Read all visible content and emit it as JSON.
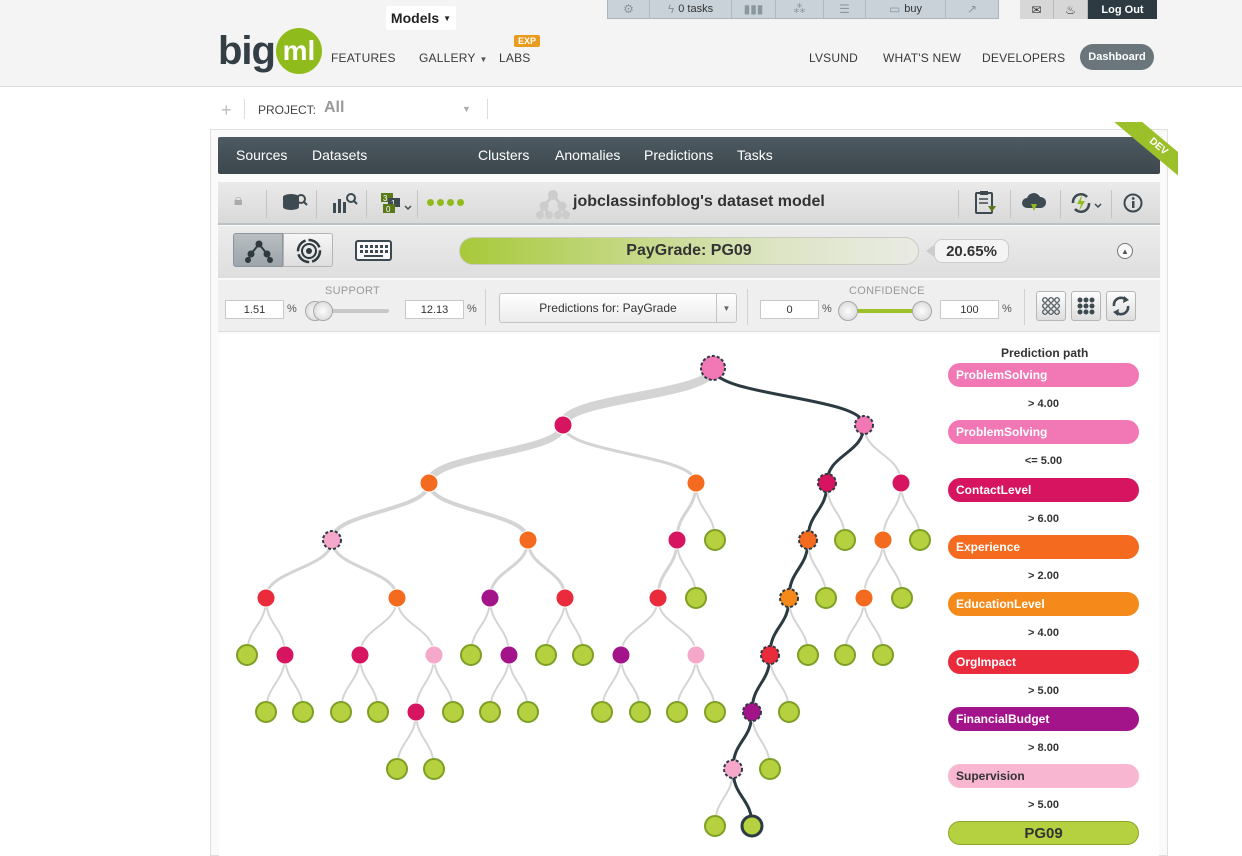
{
  "topbar": {
    "tasks_label": "0 tasks",
    "buy_label": "buy",
    "logout_label": "Log Out",
    "nav": {
      "features": "FEATURES",
      "gallery": "GALLERY",
      "labs": "LABS",
      "labs_badge": "EXP",
      "user": "LVSUND",
      "whats_new": "WHAT'S NEW",
      "developers": "DEVELOPERS",
      "dashboard": "Dashboard"
    },
    "logo": {
      "text": "big",
      "badge": "ml"
    }
  },
  "project": {
    "label": "PROJECT:",
    "value": "All"
  },
  "main_nav": {
    "tabs": [
      "Sources",
      "Datasets",
      "Models",
      "Clusters",
      "Anomalies",
      "Predictions",
      "Tasks"
    ],
    "ribbon": "DEV"
  },
  "model": {
    "title": "jobclassinfoblog's dataset model"
  },
  "prediction": {
    "label": "PayGrade: PG09",
    "percent": "20.65%"
  },
  "filters": {
    "support_label": "SUPPORT",
    "support_min": "1.51",
    "support_max": "12.13",
    "percent_sign": "%",
    "select_value": "Predictions for: PayGrade",
    "confidence_label": "CONFIDENCE",
    "confidence_min": "0",
    "confidence_max": "100"
  },
  "prediction_path": {
    "title": "Prediction path",
    "steps": [
      {
        "field": "ProblemSolving",
        "color": "#f277b5",
        "condition": "> 4.00"
      },
      {
        "field": "ProblemSolving",
        "color": "#f277b5",
        "condition": "<= 5.00"
      },
      {
        "field": "ContactLevel",
        "color": "#d6145f",
        "condition": "> 6.00"
      },
      {
        "field": "Experience",
        "color": "#f46a1f",
        "condition": "> 2.00"
      },
      {
        "field": "EducationLevel",
        "color": "#f58a1a",
        "condition": "> 4.00"
      },
      {
        "field": "OrgImpact",
        "color": "#ea2b3c",
        "condition": "> 5.00"
      },
      {
        "field": "FinancialBudget",
        "color": "#a3148a",
        "condition": "> 8.00"
      },
      {
        "field": "Supervision",
        "color": "#f8b6d1",
        "condition": "> 5.00"
      }
    ],
    "result": "PG09"
  },
  "colors": {
    "leaf": "#b5d13f",
    "leaf_border": "#7f9f24",
    "path": "#2c3a42",
    "edge": "#d4d4d4"
  }
}
